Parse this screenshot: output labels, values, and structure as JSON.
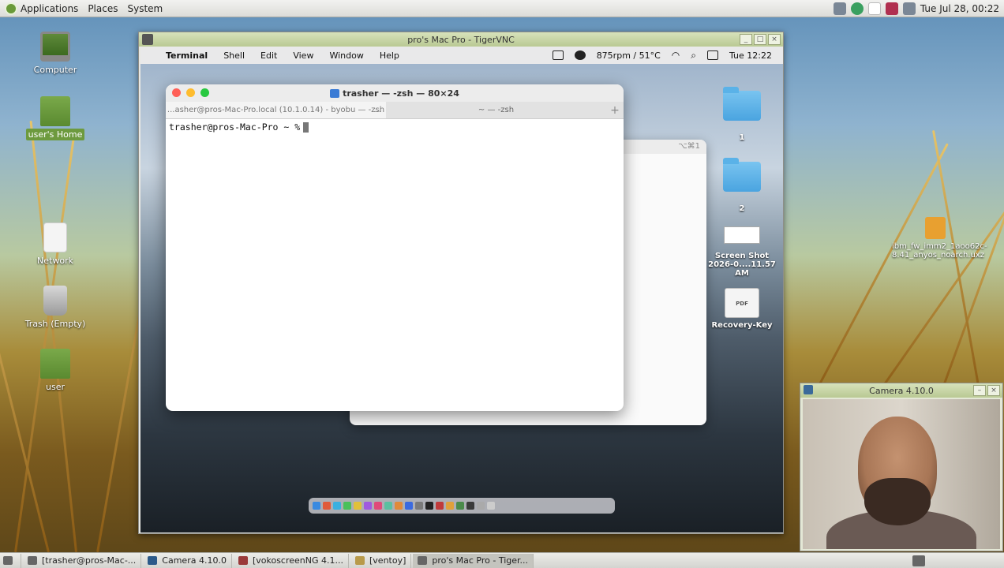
{
  "top_panel": {
    "menus": [
      "Applications",
      "Places",
      "System"
    ],
    "clock": "Tue Jul 28, 00:22"
  },
  "desktop_icons": [
    {
      "label": "Computer"
    },
    {
      "label": "user's Home"
    },
    {
      "label": "Network"
    },
    {
      "label": "Trash (Empty)"
    },
    {
      "label": "user"
    }
  ],
  "desktop_file": {
    "label": "ibm_fw_imm2_1aoo62c-8.41_anyos_noarch.uxz"
  },
  "vnc": {
    "title": "pro's Mac Pro - TigerVNC",
    "buttons": [
      "_",
      "□",
      "×"
    ]
  },
  "mac_menu": {
    "apple": "",
    "items": [
      "Terminal",
      "Shell",
      "Edit",
      "View",
      "Window",
      "Help"
    ],
    "status_fan": "875rpm / 51°C",
    "clock": "Tue 12:22"
  },
  "terminal": {
    "title": "trasher — -zsh — 80×24",
    "tabs": [
      "...asher@pros-Mac-Pro.local (10.1.0.14) - byobu — -zsh",
      "~ — -zsh"
    ],
    "tab_more": "...",
    "tab_add": "+",
    "prompt": "trasher@pros-Mac-Pro ~ %"
  },
  "back_window": {
    "shortcut": "⌥⌘1"
  },
  "mac_desktop_icons": [
    {
      "label": "1"
    },
    {
      "label": "2"
    },
    {
      "label": "Screen Shot 2026-0....11.57 AM"
    },
    {
      "label": "Recovery-Key",
      "badge": "PDF"
    }
  ],
  "camera": {
    "title": "Camera 4.10.0",
    "buttons": [
      "–",
      "×"
    ]
  },
  "taskbar": {
    "tasks": [
      "[trasher@pros-Mac-...",
      "Camera 4.10.0",
      "[vokoscreenNG 4.1...",
      "[ventoy]",
      "pro's Mac Pro - Tiger..."
    ]
  }
}
